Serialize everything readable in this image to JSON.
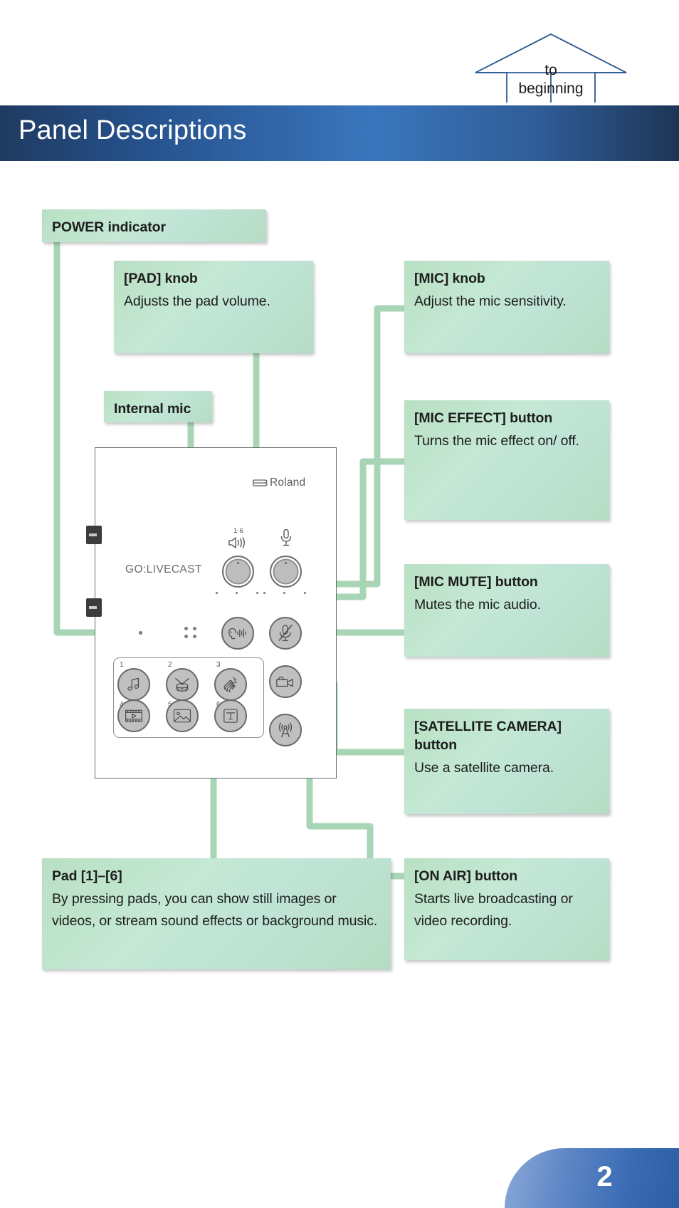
{
  "header": {
    "to_beginning_line1": "to",
    "to_beginning_line2": "beginning",
    "title": "Panel Descriptions"
  },
  "callouts": {
    "power": {
      "title": "POWER indicator",
      "desc": ""
    },
    "pad_knob": {
      "title": "[PAD] knob",
      "desc": "Adjusts the pad volume."
    },
    "mic_knob": {
      "title": "[MIC] knob",
      "desc": "Adjust the mic sensitivity."
    },
    "internal_mic": {
      "title": "Internal mic",
      "desc": ""
    },
    "mic_effect": {
      "title": "[MIC EFFECT] button",
      "desc": "Turns the mic effect on/ off."
    },
    "mic_mute": {
      "title": "[MIC MUTE] button",
      "desc": "Mutes the mic audio."
    },
    "satellite_camera": {
      "title": "[SATELLITE CAMERA] button",
      "desc": "Use a satellite camera."
    },
    "pads": {
      "title": "Pad [1]–[6]",
      "desc": "By pressing pads, you can show still images or videos, or stream sound effects or background music."
    },
    "on_air": {
      "title": "[ON AIR] button",
      "desc": "Starts live broadcasting or video recording."
    }
  },
  "device": {
    "brand": "Roland",
    "model": "GO:LIVECAST",
    "pad_knob_range": "1-6",
    "pad_numbers": [
      "1",
      "2",
      "3",
      "4",
      "5",
      "6"
    ],
    "pad_icons": [
      "music-note-icon",
      "drum-icon",
      "clap-hands-icon",
      "film-strip-icon",
      "picture-icon",
      "text-title-icon"
    ],
    "buttons": [
      "mic-effect-icon",
      "mic-mute-icon",
      "satellite-camera-icon",
      "on-air-broadcast-icon"
    ],
    "knobs": [
      "pad-volume-knob",
      "mic-sensitivity-knob"
    ]
  },
  "footer": {
    "page_number": "2"
  },
  "colors": {
    "callout_fill": "#bfe4cf",
    "connector": "#a8d5b5",
    "band_blue": "#2b5b95",
    "badge_blue": "#3a6cb4",
    "arrow_stroke": "#2e5c92"
  }
}
